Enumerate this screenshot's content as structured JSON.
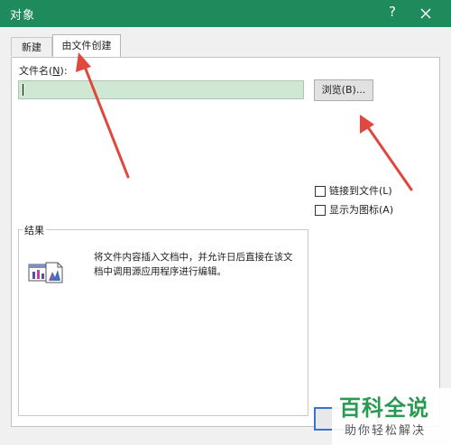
{
  "window": {
    "title": "对象",
    "help_label": "?",
    "close_icon": "close-icon"
  },
  "tabs": [
    {
      "label": "新建",
      "active": false
    },
    {
      "label": "由文件创建",
      "active": true
    }
  ],
  "file": {
    "label_prefix": "文件名(",
    "label_hotkey": "N",
    "label_suffix": "):",
    "value": "",
    "browse_label": "浏览(B)..."
  },
  "options": {
    "link_label": "链接到文件(L)",
    "link_checked": false,
    "icon_label": "显示为图标(A)",
    "icon_checked": false
  },
  "result": {
    "title": "结果",
    "icon": "embedded-object-icon",
    "text": "将文件内容插入文档中，并允许日后直接在该文档中调用源应用程序进行编辑。"
  },
  "watermark": {
    "title": "百科全说",
    "subtitle": "助你轻松解决"
  },
  "colors": {
    "titlebar": "#1f8a5b",
    "input_fill": "#cfe7d3",
    "annotation_arrow": "#e0473d",
    "watermark_green": "#2a9a52"
  }
}
